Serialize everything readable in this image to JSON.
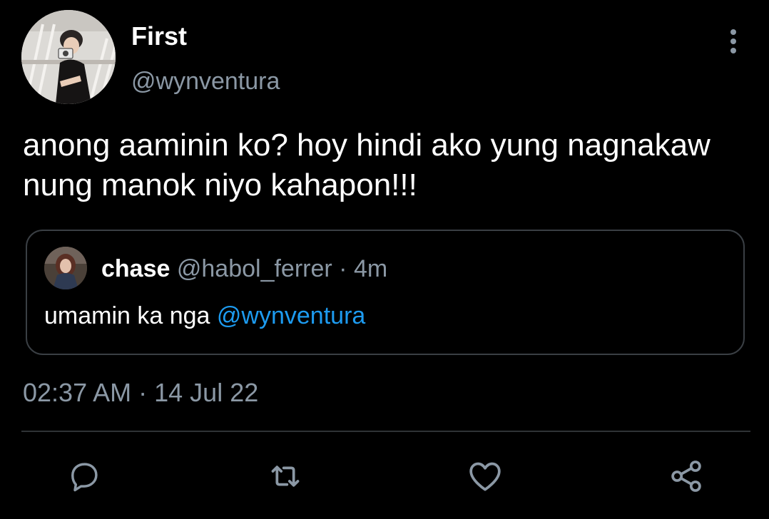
{
  "author": {
    "display_name": "First",
    "handle": "@wynventura"
  },
  "tweet": {
    "text": "anong aaminin ko? hoy hindi ako yung nagnakaw nung manok niyo kahapon!!!"
  },
  "quoted": {
    "display_name": "chase",
    "handle": "@habol_ferrer",
    "separator": "·",
    "time": "4m",
    "text": "umamin ka nga",
    "mention": "@wynventura"
  },
  "meta": {
    "time": "02:37 AM",
    "separator": "·",
    "date": "14 Jul 22"
  },
  "actions": {
    "reply_icon": "reply-icon",
    "retweet_icon": "retweet-icon",
    "like_icon": "heart-icon",
    "share_icon": "share-icon"
  },
  "colors": {
    "background": "#000000",
    "text": "#ffffff",
    "secondary": "#8b98a5",
    "accent": "#1d9bf0",
    "border": "#3a3f44"
  }
}
